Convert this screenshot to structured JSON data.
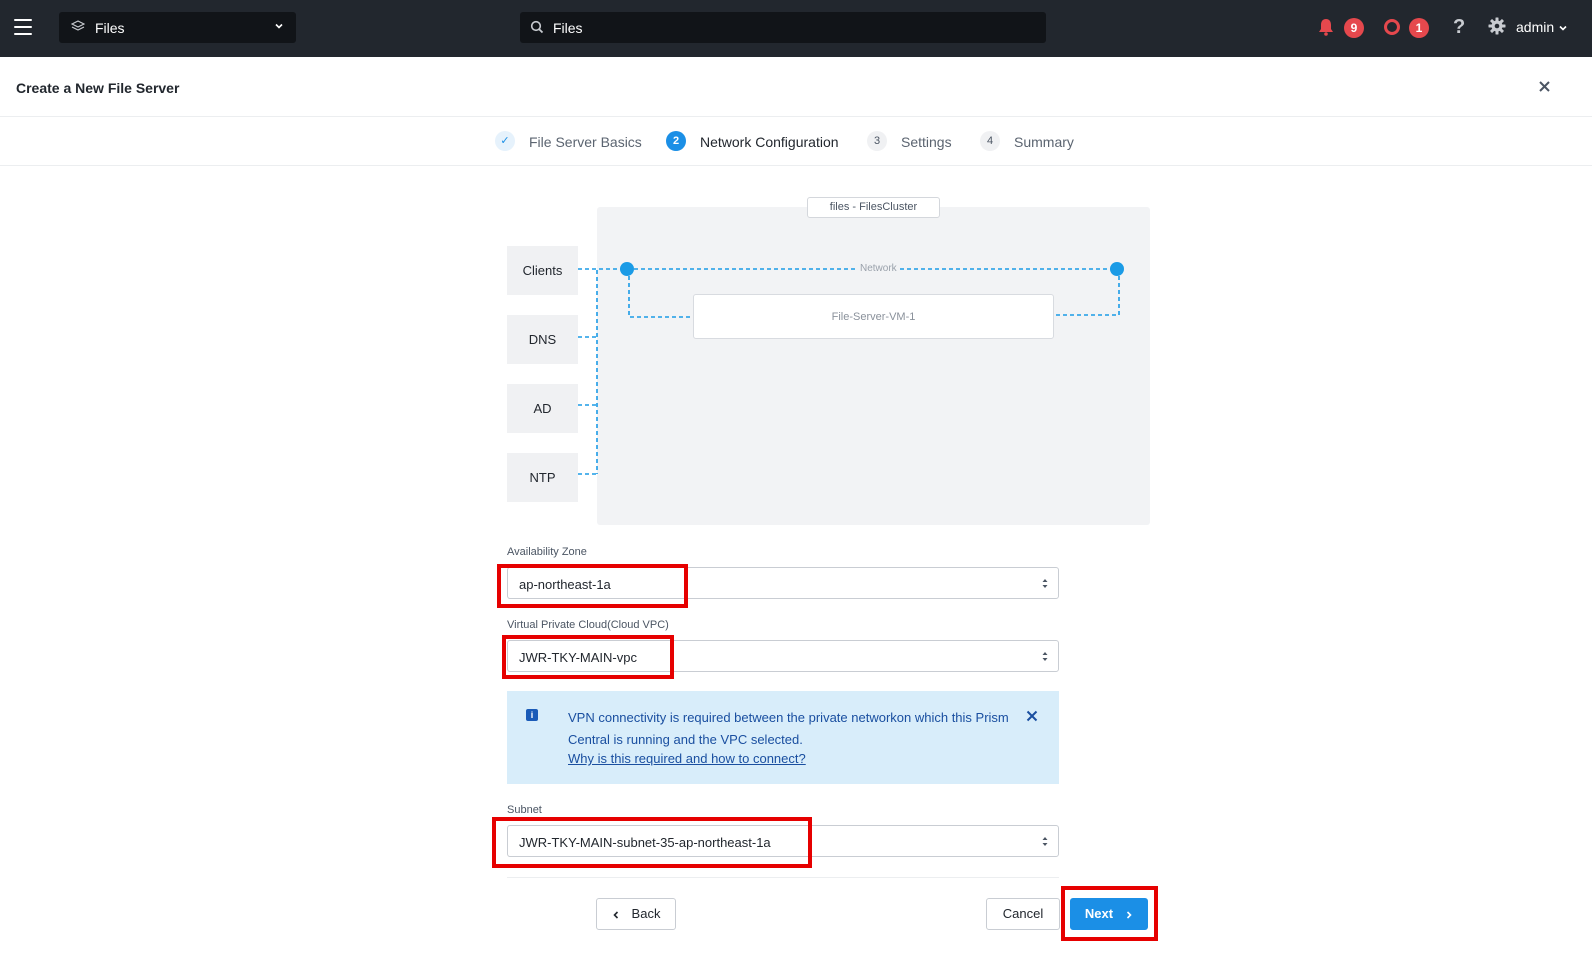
{
  "topbar": {
    "app_name": "Files",
    "search_value": "Files",
    "alerts_count": "9",
    "events_count": "1",
    "help": "?",
    "user": "admin"
  },
  "header": {
    "title": "Create a New File Server"
  },
  "stepper": {
    "steps": [
      {
        "num": "✓",
        "label": "File Server Basics",
        "state": "done"
      },
      {
        "num": "2",
        "label": "Network Configuration",
        "state": "active"
      },
      {
        "num": "3",
        "label": "Settings",
        "state": "todo"
      },
      {
        "num": "4",
        "label": "Summary",
        "state": "todo"
      }
    ]
  },
  "diagram": {
    "cluster_label": "files - FilesCluster",
    "network_label": "Network",
    "vm_label": "File-Server-VM-1",
    "services": [
      "Clients",
      "DNS",
      "AD",
      "NTP"
    ]
  },
  "form": {
    "availability_zone_label": "Availability Zone",
    "availability_zone_value": "ap-northeast-1a",
    "vpc_label": "Virtual Private Cloud(Cloud VPC)",
    "vpc_value": "JWR-TKY-MAIN-vpc",
    "info_message": "VPN connectivity is required between the private networkon which this Prism Central is running and the VPC selected.",
    "info_link": "Why is this required and how to connect?",
    "subnet_label": "Subnet",
    "subnet_value": "JWR-TKY-MAIN-subnet-35-ap-northeast-1a"
  },
  "buttons": {
    "back": "Back",
    "cancel": "Cancel",
    "next": "Next"
  },
  "colors": {
    "topbar": "#22272e",
    "accent": "#1b8fe6",
    "badge": "#e5484d",
    "highlight": "#e60000",
    "info_bg": "#d8edfa"
  }
}
